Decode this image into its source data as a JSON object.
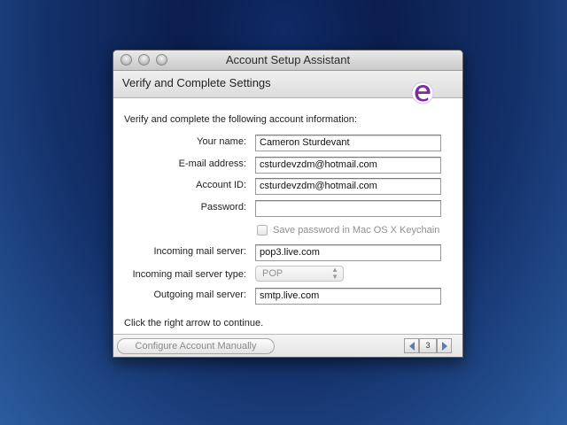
{
  "window": {
    "title": "Account Setup Assistant",
    "header": "Verify and Complete Settings",
    "logo_icon": "entourage-e-icon"
  },
  "form": {
    "intro": "Verify and complete the following account information:",
    "name_label": "Your name:",
    "name_value": "Cameron Sturdevant",
    "email_label": "E-mail address:",
    "email_value": "csturdevzdm@hotmail.com",
    "account_label": "Account ID:",
    "account_value": "csturdevzdm@hotmail.com",
    "password_label": "Password:",
    "password_value": "",
    "keychain_label": "Save password in Mac OS X Keychain",
    "incoming_label": "Incoming mail server:",
    "incoming_value": "pop3.live.com",
    "incoming_type_label": "Incoming mail server type:",
    "incoming_type_value": "POP",
    "outgoing_label": "Outgoing mail server:",
    "outgoing_value": "smtp.live.com",
    "continue_text": "Click the right arrow to continue."
  },
  "footer": {
    "configure_label": "Configure Account Manually",
    "page": "3"
  },
  "colors": {
    "desktop_top": "#0b1e4d",
    "desktop_bottom": "#2b5c9f",
    "logo_purple": "#7b2c9e"
  }
}
